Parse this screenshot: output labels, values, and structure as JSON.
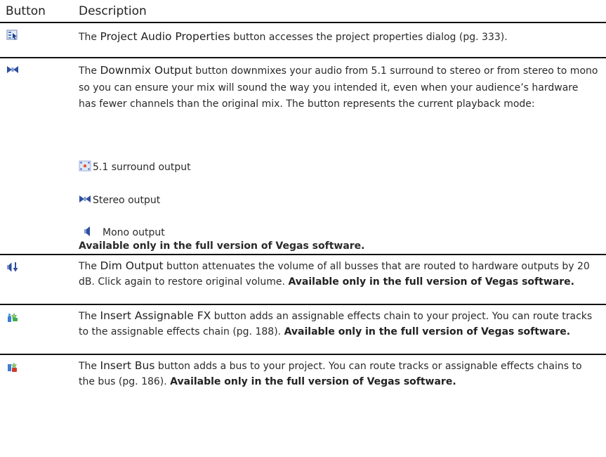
{
  "header": {
    "button_col": "Button",
    "description_col": "Description"
  },
  "rows": [
    {
      "icon": "project-audio-properties-icon",
      "pre": "The ",
      "term": "Project Audio Properties",
      "post": " button accesses the project properties dialog (pg. 333)."
    },
    {
      "icon": "downmix-output-icon",
      "pre": "The ",
      "term": "Downmix Output",
      "post": " button downmixes your audio from 5.1 surround to stereo or from stereo to mono so you can ensure your mix will sound the way you intended it, even when your audience’s hardware has fewer channels than the original mix. The button represents the current playback mode:",
      "modes": [
        {
          "icon": "surround-output-icon",
          "label": "5.1 surround output"
        },
        {
          "icon": "stereo-output-icon",
          "label": "Stereo output"
        },
        {
          "icon": "mono-output-icon",
          "label": "Mono output"
        }
      ],
      "note": "Available only in the full version of Vegas software."
    },
    {
      "icon": "dim-output-icon",
      "pre": "The ",
      "term": "Dim Output",
      "post": " button attenuates the volume of all busses that are routed to hardware outputs by 20 dB. Click again to restore original volume. ",
      "note": "Available only in the full version of Vegas software."
    },
    {
      "icon": "insert-assignable-fx-icon",
      "pre": "The ",
      "term": "Insert Assignable FX",
      "post": " button adds an assignable effects chain to your project. You can route tracks to the assignable effects chain (pg. 188). ",
      "note": "Available only in the full version of Vegas software."
    },
    {
      "icon": "insert-bus-icon",
      "pre": "The ",
      "term": "Insert Bus",
      "post": " button adds a bus to your project. You can route tracks or assignable effects chains to the bus (pg. 186). ",
      "note": "Available only in the full version of Vegas software."
    }
  ]
}
